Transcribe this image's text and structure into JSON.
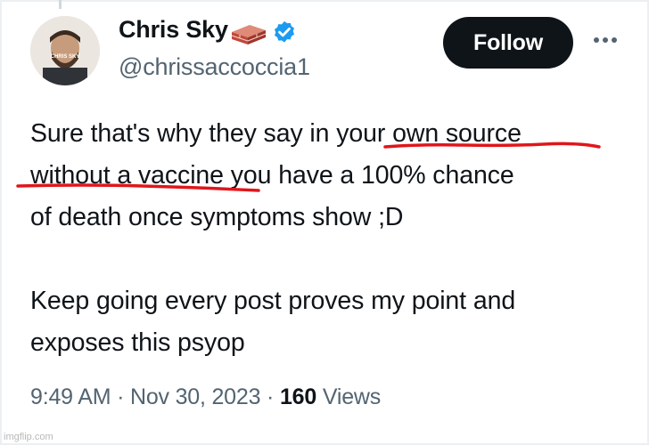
{
  "tweet": {
    "author_name": "Chris Sky",
    "handle": "@chrissaccoccia1",
    "avatar_text": "CHRIS SKY",
    "follow_label": "Follow",
    "lines": [
      "Sure that's why they say in your own source",
      "without a vaccine you have a 100% chance",
      "of death once symptoms show ;D",
      "Keep going every post proves my point and",
      "exposes this psyop"
    ],
    "time": "9:49 AM",
    "separator": "·",
    "date": "Nov 30, 2023",
    "views_count": "160",
    "views_label": "Views"
  },
  "watermark": "imgflip.com",
  "icons": {
    "verified": "verified-badge-icon",
    "brick": "brick-emoji-icon",
    "more": "more-options-icon"
  },
  "colors": {
    "verified": "#1d9bf0",
    "follow_bg": "#0f1419",
    "secondary_text": "#536471",
    "annotation": "#e0161b",
    "brick": "#c0493a"
  }
}
